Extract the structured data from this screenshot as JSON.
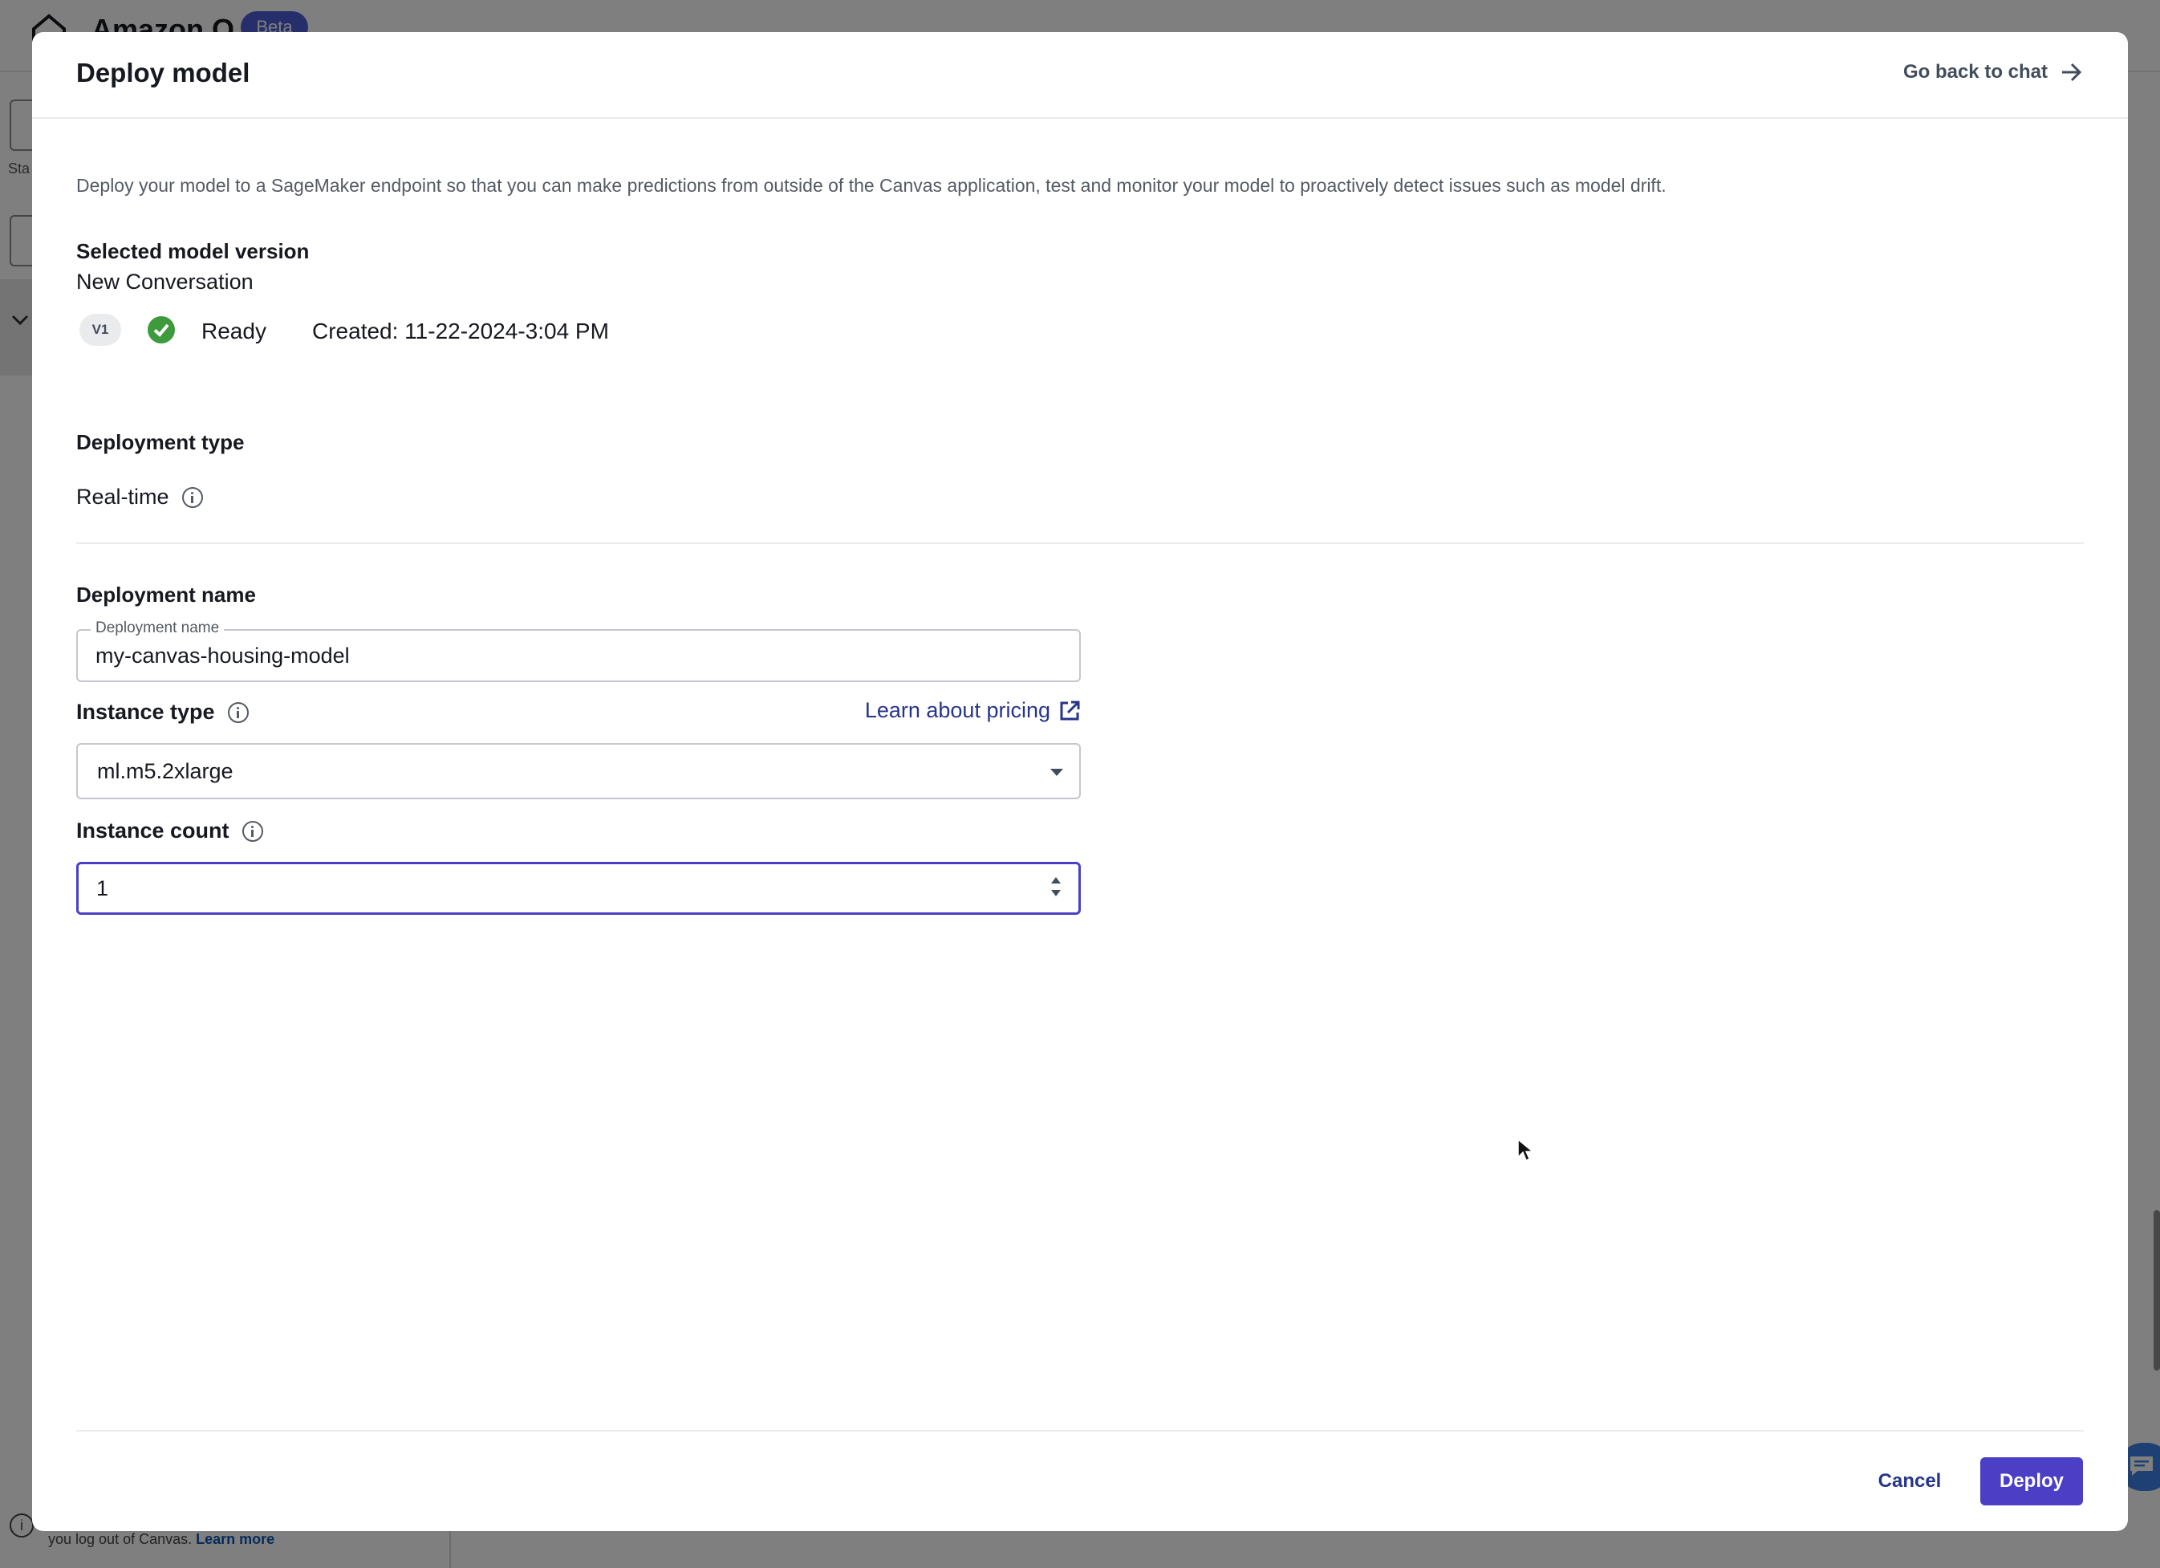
{
  "background": {
    "app_title": "Amazon Q",
    "beta_badge": "Beta",
    "sidebar_text": "Sta",
    "footer_text": "you log out of Canvas.",
    "footer_link": "Learn more"
  },
  "modal": {
    "title": "Deploy model",
    "go_back_label": "Go back to chat",
    "description": "Deploy your model to a SageMaker endpoint so that you can make predictions from outside of the Canvas application, test and monitor your model to proactively detect issues such as model drift.",
    "selected_model": {
      "heading": "Selected model version",
      "model_name": "New Conversation",
      "version_badge": "V1",
      "status": "Ready",
      "created": "Created: 11-22-2024-3:04 PM"
    },
    "deployment_type": {
      "heading": "Deployment type",
      "value": "Real-time"
    },
    "deployment_name": {
      "heading": "Deployment name",
      "floating_label": "Deployment name",
      "value": "my-canvas-housing-model"
    },
    "instance_type": {
      "label": "Instance type",
      "pricing_link": "Learn about pricing",
      "selected": "ml.m5.2xlarge"
    },
    "instance_count": {
      "label": "Instance count",
      "value": "1"
    },
    "buttons": {
      "cancel": "Cancel",
      "deploy": "Deploy"
    }
  },
  "colors": {
    "primary": "#4b3fc6",
    "link": "#26348c",
    "success": "#3d9a3d",
    "overlay": "rgba(0,0,0,0.5)"
  }
}
